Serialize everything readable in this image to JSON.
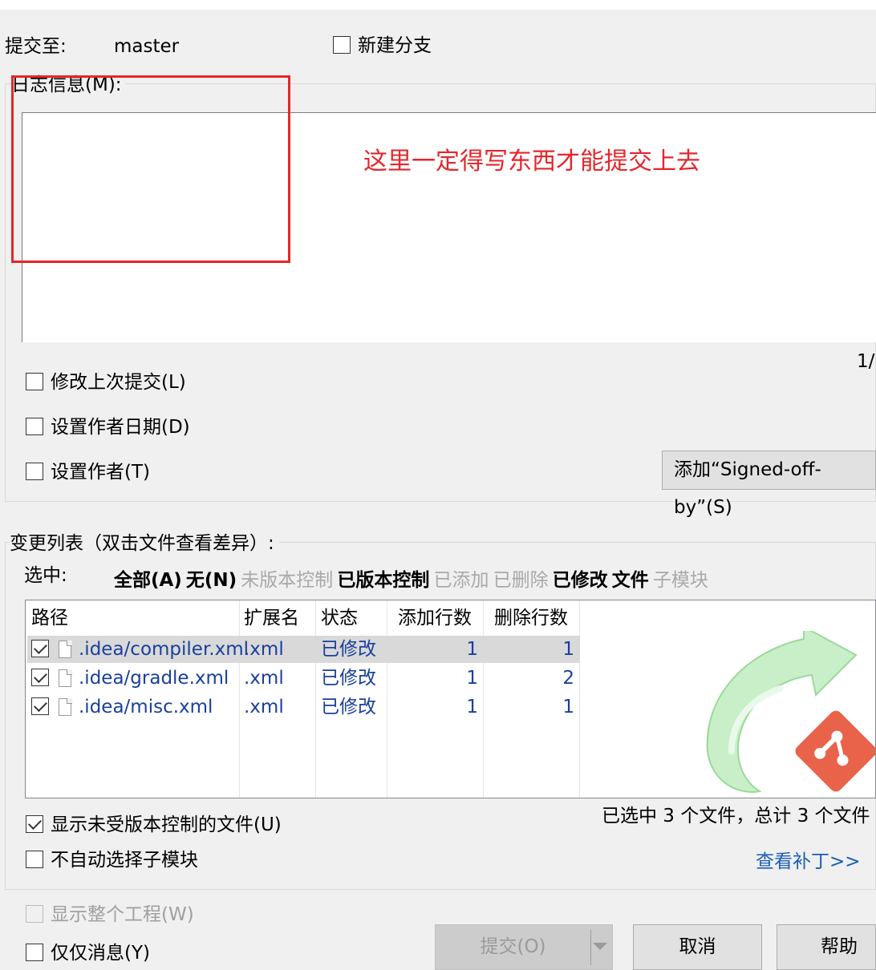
{
  "commit_to": {
    "label": "提交至:",
    "branch": "master"
  },
  "new_branch": {
    "label": "新建分支",
    "checked": false
  },
  "message": {
    "label": "日志信息(M):",
    "value": "",
    "counter": "1/"
  },
  "annotation": {
    "text": "这里一定得写东西才能提交上去",
    "color": "#e5262b"
  },
  "options": {
    "amend": "修改上次提交(L)",
    "set_author_date": "设置作者日期(D)",
    "set_author": "设置作者(T)",
    "signed_off_button": "添加“Signed-off-by”(S)"
  },
  "changes": {
    "label": "变更列表（双击文件查看差异）:",
    "select_label": "选中:",
    "select_options": [
      {
        "label": "全部(A)",
        "enabled": true
      },
      {
        "label": "无(N)",
        "enabled": true
      },
      {
        "label": "未版本控制",
        "enabled": false
      },
      {
        "label": "已版本控制",
        "enabled": true
      },
      {
        "label": "已添加",
        "enabled": false
      },
      {
        "label": "已删除",
        "enabled": false
      },
      {
        "label": "已修改",
        "enabled": true
      },
      {
        "label": "文件",
        "enabled": true
      },
      {
        "label": "子模块",
        "enabled": false
      }
    ],
    "columns": [
      "路径",
      "扩展名",
      "状态",
      "添加行数",
      "删除行数"
    ],
    "rows": [
      {
        "path": ".idea/compiler.xml",
        "ext": ".xml",
        "status": "已修改",
        "added": "1",
        "removed": "1",
        "checked": true,
        "selected": true
      },
      {
        "path": ".idea/gradle.xml",
        "ext": ".xml",
        "status": "已修改",
        "added": "1",
        "removed": "2",
        "checked": true,
        "selected": false
      },
      {
        "path": ".idea/misc.xml",
        "ext": ".xml",
        "status": "已修改",
        "added": "1",
        "removed": "1",
        "checked": true,
        "selected": false
      }
    ],
    "summary": "已选中 3 个文件，总计 3 个文件",
    "show_unversioned": "显示未受版本控制的文件(U)",
    "no_auto_select_submodules": "不自动选择子模块",
    "view_patch": "查看补丁>>"
  },
  "footer": {
    "show_whole_project": "显示整个工程(W)",
    "message_only": "仅仅消息(Y)",
    "commit_button": "提交(O)",
    "cancel_button": "取消",
    "help_button": "帮助"
  },
  "icons": {
    "watermark": "tortoisegit-commit-arrow-icon",
    "git_logo": "git-logo-icon",
    "file": "file-icon",
    "dropdown": "chevron-down-icon"
  },
  "colors": {
    "link": "#1a5fb4",
    "list_text": "#1a3f9e",
    "annotation": "#e5262b"
  }
}
